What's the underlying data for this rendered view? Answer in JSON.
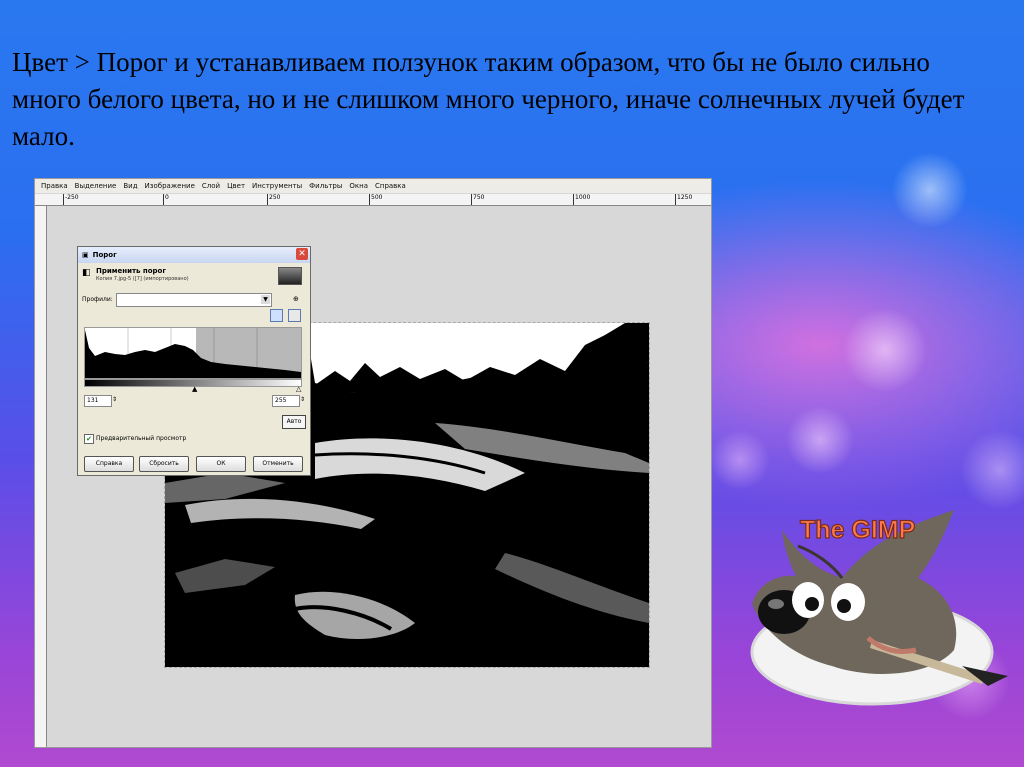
{
  "slide": {
    "heading": "Цвет > Порог и устанавливаем ползунок таким образом, что бы не было сильно много белого цвета, но и не слишком много черного, иначе солнечных лучей будет мало."
  },
  "gimp": {
    "menu": [
      "Правка",
      "Выделение",
      "Вид",
      "Изображение",
      "Слой",
      "Цвет",
      "Инструменты",
      "Фильтры",
      "Окна",
      "Справка"
    ],
    "ruler_ticks": [
      "-250",
      "0",
      "250",
      "500",
      "750",
      "1000",
      "1250"
    ]
  },
  "dialog": {
    "title": "Порог",
    "subtitle": "Применить порог",
    "image_name": "Копия 7.jpg-5 ([7] (импортировано)",
    "profiles_label": "Профили:",
    "profile_value": "",
    "low": "131",
    "high": "255",
    "auto_label": "Авто",
    "preview_label": "Предварительный просмотр",
    "preview_checked": true,
    "threshold_fraction": 0.514,
    "buttons": {
      "help": "Справка",
      "reset": "Сбросить",
      "ok": "ОК",
      "cancel": "Отменить"
    }
  },
  "logo": {
    "text": "The GIMP"
  }
}
